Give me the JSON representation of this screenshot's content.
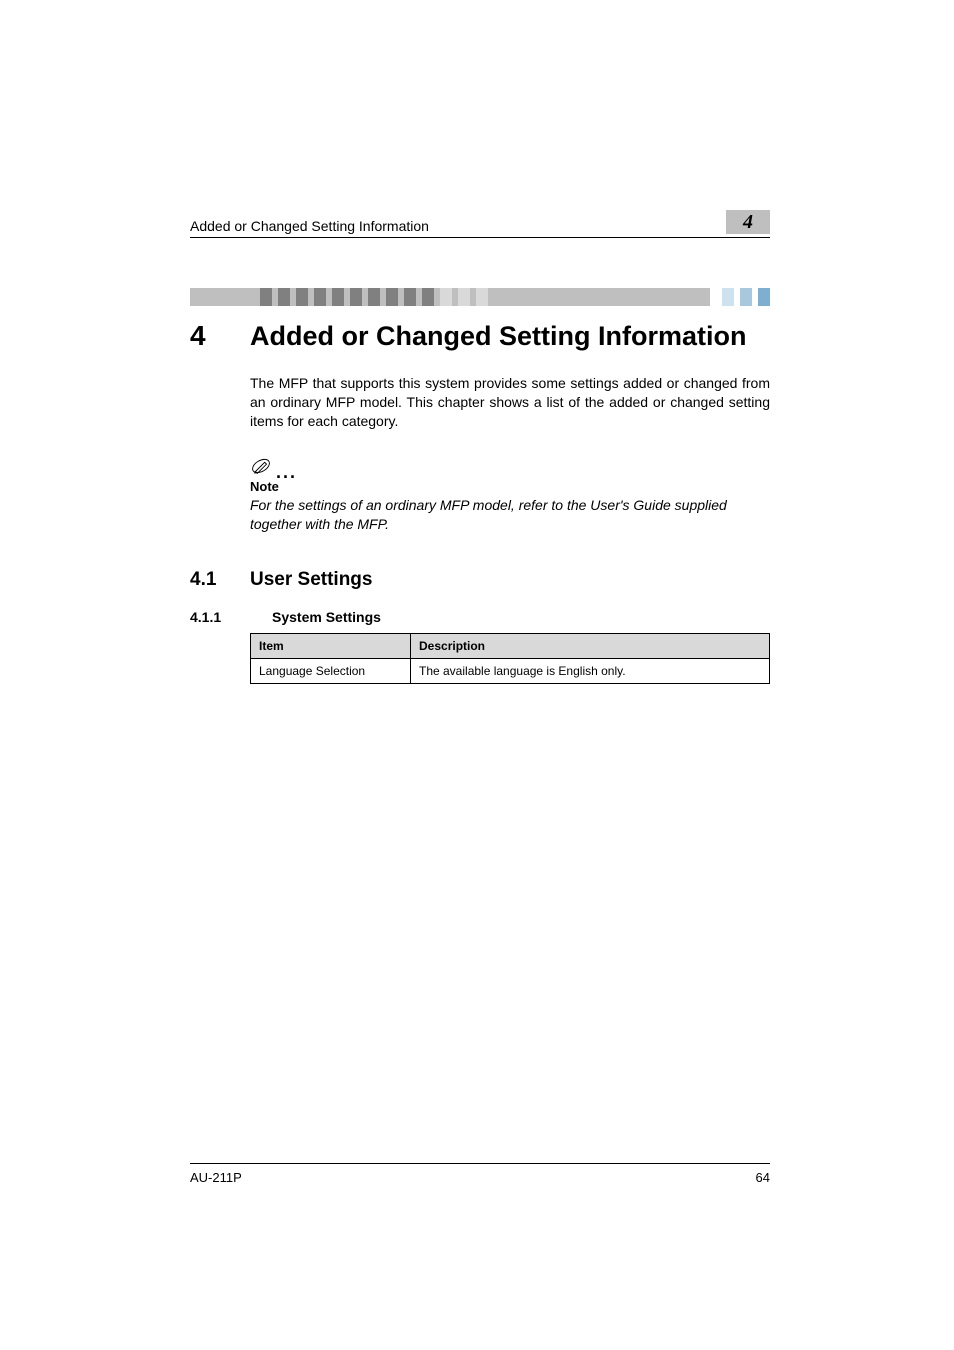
{
  "header": {
    "running_title": "Added or Changed Setting Information",
    "chapter_badge": "4"
  },
  "chapter": {
    "number": "4",
    "title": "Added or Changed Setting Information"
  },
  "intro": "The MFP that supports this system provides some settings added or changed from an ordinary MFP model. This chapter shows a list of the added or changed setting items for each category.",
  "note": {
    "head": "Note",
    "body": "For the settings of an ordinary MFP model, refer to the User's Guide supplied together with the MFP."
  },
  "section": {
    "number": "4.1",
    "title": "User Settings"
  },
  "subsection": {
    "number": "4.1.1",
    "title": "System Settings"
  },
  "table": {
    "head_item": "Item",
    "head_desc": "Description",
    "row1_item": "Language Selection",
    "row1_desc": "The available language is English only."
  },
  "footer": {
    "model": "AU-211P",
    "page": "64"
  }
}
